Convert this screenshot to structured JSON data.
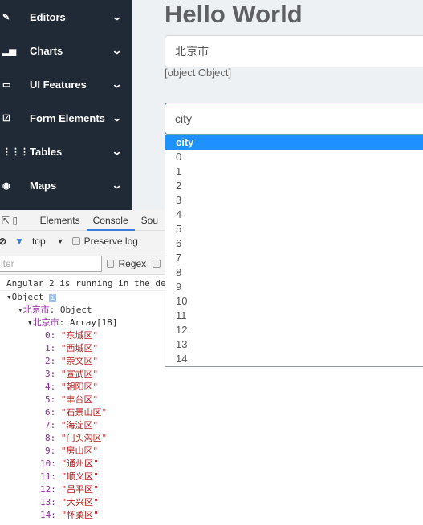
{
  "sidebar": {
    "items": [
      {
        "label": "Editors",
        "icon": "pencil-icon",
        "glyph": "✎"
      },
      {
        "label": "Charts",
        "icon": "bar-chart-icon",
        "glyph": "▂▅"
      },
      {
        "label": "UI Features",
        "icon": "monitor-icon",
        "glyph": "▭"
      },
      {
        "label": "Form Elements",
        "icon": "edit-icon",
        "glyph": "☑"
      },
      {
        "label": "Tables",
        "icon": "grid-icon",
        "glyph": "⋮⋮⋮"
      },
      {
        "label": "Maps",
        "icon": "map-pin-icon",
        "glyph": "◉"
      }
    ],
    "chevron": "⌄"
  },
  "main": {
    "title": "Hello World",
    "city_value": "北京市",
    "object_text": "[object Object]",
    "select_value": "city"
  },
  "dropdown": {
    "options": [
      "city",
      "0",
      "1",
      "2",
      "3",
      "4",
      "5",
      "6",
      "7",
      "8",
      "9",
      "10",
      "11",
      "12",
      "13",
      "14"
    ],
    "selected": "city"
  },
  "devtools": {
    "tabs": [
      "Elements",
      "Console",
      "Sou"
    ],
    "active_tab": "Console",
    "context": "top",
    "preserve_log": "Preserve log",
    "filter_placeholder": "lter",
    "regex": "Regex",
    "log_message": "Angular 2 is running in the de",
    "tree": {
      "root": "Object",
      "level1_key": "北京市",
      "level1_type": "Object",
      "level2_key": "北京市",
      "level2_type": "Array[18]",
      "entries": [
        "东城区",
        "西城区",
        "崇文区",
        "宣武区",
        "朝阳区",
        "丰台区",
        "石景山区",
        "海淀区",
        "门头沟区",
        "房山区",
        "通州区",
        "顺义区",
        "昌平区",
        "大兴区",
        "怀柔区"
      ]
    }
  }
}
